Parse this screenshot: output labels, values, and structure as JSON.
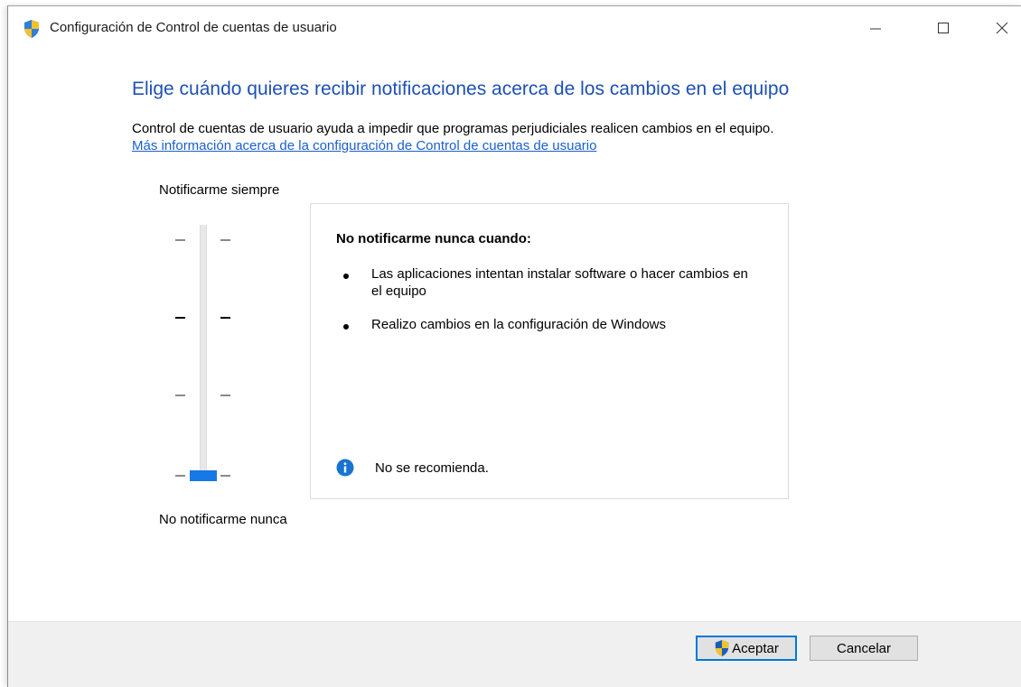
{
  "window": {
    "title": "Configuración de Control de cuentas de usuario"
  },
  "content": {
    "heading": "Elige cuándo quieres recibir notificaciones acerca de los cambios en el equipo",
    "description": "Control de cuentas de usuario ayuda a impedir que programas perjudiciales realicen cambios en el equipo.",
    "link_text": "Más información acerca de la configuración de Control de cuentas de usuario"
  },
  "slider": {
    "top_label": "Notificarme siempre",
    "bottom_label": "No notificarme nunca",
    "levels": 4,
    "selected_level": 0
  },
  "info": {
    "title": "No notificarme nunca cuando:",
    "bullets": [
      "Las aplicaciones intentan instalar software o hacer cambios en el equipo",
      "Realizo cambios en la configuración de Windows"
    ],
    "recommendation": "No se recomienda."
  },
  "buttons": {
    "accept": "Aceptar",
    "cancel": "Cancelar"
  },
  "colors": {
    "heading": "#1e50b4",
    "link": "#1a5fcc",
    "accent": "#1779e6",
    "info_icon": "#1874d2"
  }
}
